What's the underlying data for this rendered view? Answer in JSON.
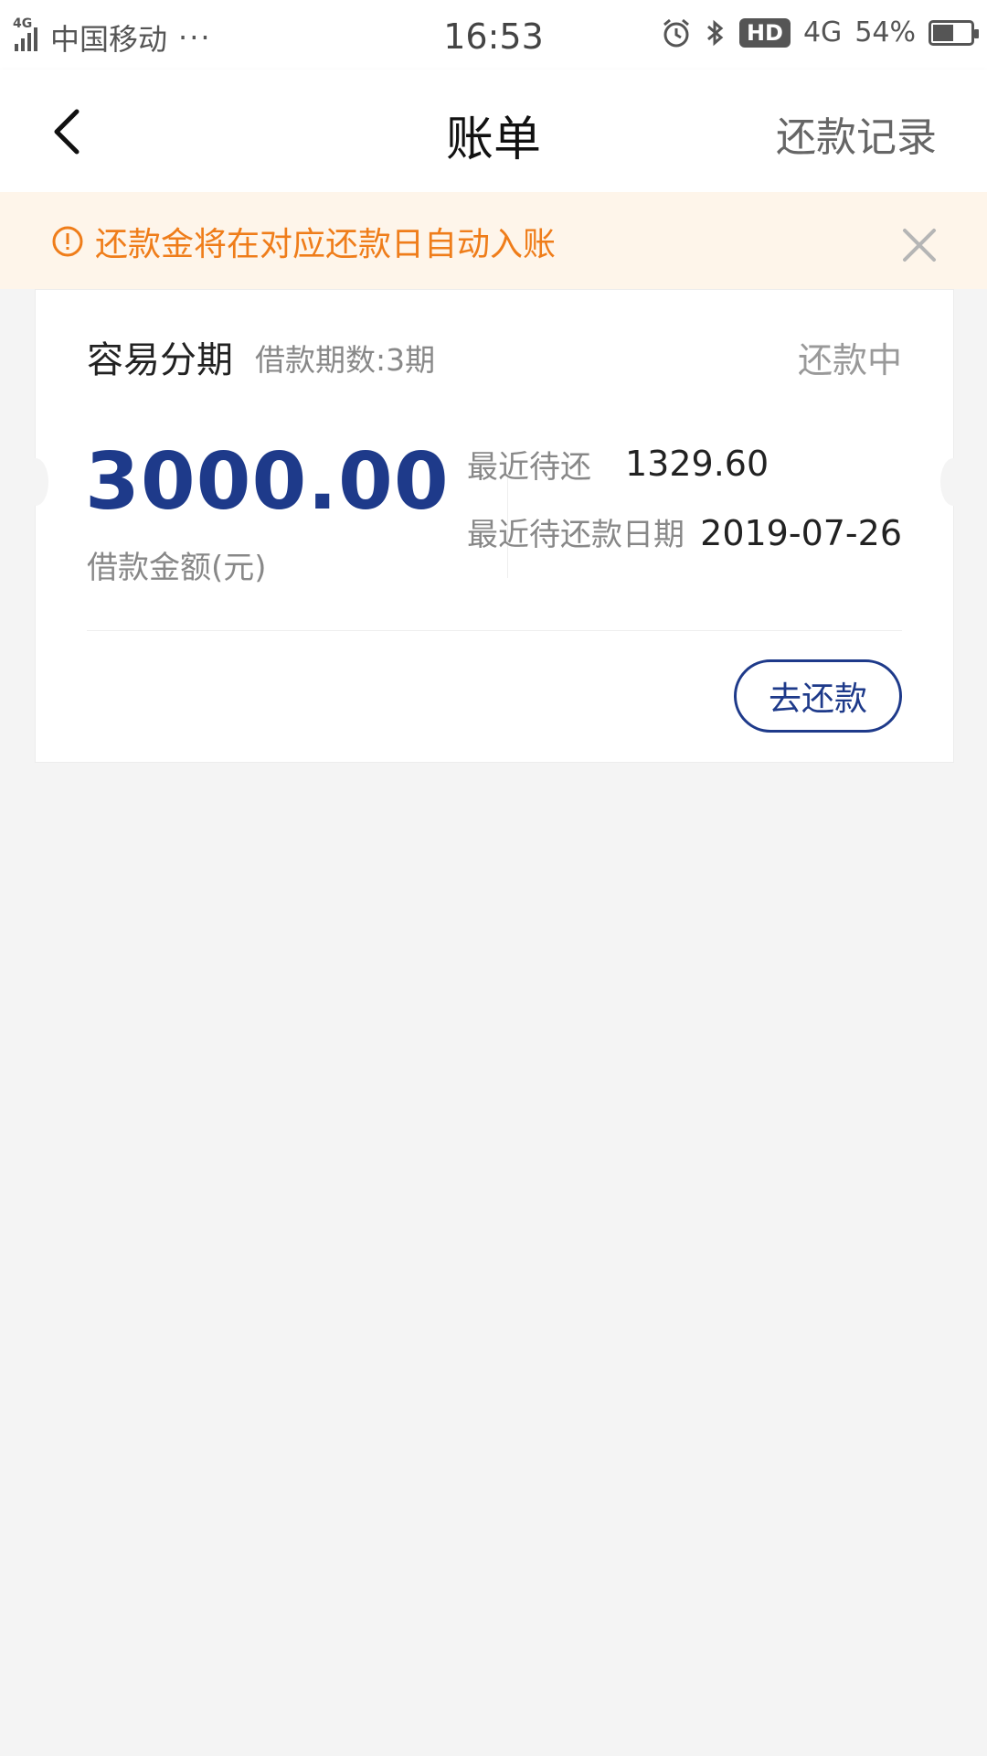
{
  "status_bar": {
    "network": "4G",
    "carrier": "中国移动",
    "more": "···",
    "time": "16:53",
    "hd": "HD",
    "data": "4G",
    "battery": "54%"
  },
  "nav": {
    "title": "账单",
    "right_link": "还款记录",
    "back_icon": "chevron-left-icon"
  },
  "notice": {
    "text": "还款金将在对应还款日自动入账",
    "icon": "alert-circle-icon",
    "close_icon": "close-icon",
    "color": "#ef7d1a",
    "background": "#fef5ea"
  },
  "bill": {
    "product": "容易分期",
    "periods": "借款期数:3期",
    "status": "还款中",
    "amount": "3000.00",
    "amount_label": "借款金额(元)",
    "next_due_label": "最近待还",
    "next_due_value": "1329.60",
    "next_due_date_label": "最近待还款日期",
    "next_due_date_value": "2019-07-26",
    "repay_button": "去还款",
    "accent_color": "#1e3a8a"
  }
}
